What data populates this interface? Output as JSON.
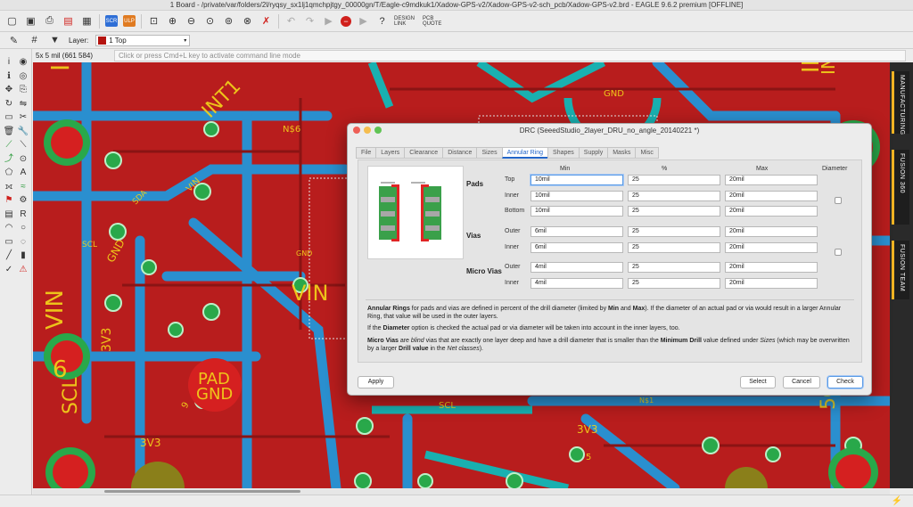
{
  "window": {
    "title": "1 Board - /private/var/folders/2l/ryqsy_sx1lj1qmchpjtgy_00000gn/T/Eagle-c9mdkuk1/Xadow-GPS-v2/Xadow-GPS-v2-sch_pcb/Xadow-GPS-v2.brd - EAGLE 9.6.2 premium [OFFLINE]"
  },
  "toolbar": {
    "design_link": "DESIGN LINK",
    "pcb_quote": "PCB QUOTE",
    "scr": "SCR",
    "ulp": "ULP"
  },
  "layerbar": {
    "label": "Layer:",
    "selected": "1 Top",
    "swatch_color": "#b4140f"
  },
  "command": {
    "coord": "5x 5 mil (661 584)",
    "placeholder": "Click or press Cmd+L key to activate command line mode"
  },
  "right_tabs": [
    "MANUFACTURING",
    "FUSION 360",
    "FUSION TEAM"
  ],
  "canvas_labels": [
    "INT1",
    "INT1",
    "INT1",
    "INT1",
    "VIN",
    "3V3",
    "VIN",
    "PAD",
    "GND",
    "GND",
    "GND",
    "SCL",
    "SCL",
    "5CL",
    "3V3",
    "3V3",
    "N$6",
    "N$1",
    "GND",
    "VIN",
    "SCL",
    "SDA",
    "6",
    "9",
    "1",
    "5"
  ],
  "dialog": {
    "title": "DRC (SeeedStudio_2layer_DRU_no_angle_20140221 *)",
    "tabs": [
      "File",
      "Layers",
      "Clearance",
      "Distance",
      "Sizes",
      "Annular Ring",
      "Shapes",
      "Supply",
      "Masks",
      "Misc"
    ],
    "active_tab": "Annular Ring",
    "col_min": "Min",
    "col_pct": "%",
    "col_max": "Max",
    "col_diameter": "Diameter",
    "groups": {
      "pads": "Pads",
      "vias": "Vias",
      "micro_vias": "Micro Vias"
    },
    "rows": [
      {
        "label": "Top",
        "min": "10mil",
        "pct": "25",
        "max": "20mil"
      },
      {
        "label": "Inner",
        "min": "10mil",
        "pct": "25",
        "max": "20mil"
      },
      {
        "label": "Bottom",
        "min": "10mil",
        "pct": "25",
        "max": "20mil"
      },
      {
        "label": "Outer",
        "min": "6mil",
        "pct": "25",
        "max": "20mil"
      },
      {
        "label": "Inner",
        "min": "6mil",
        "pct": "25",
        "max": "20mil"
      },
      {
        "label": "Outer",
        "min": "4mil",
        "pct": "25",
        "max": "20mil"
      },
      {
        "label": "Inner",
        "min": "4mil",
        "pct": "25",
        "max": "20mil"
      }
    ],
    "desc1": "Annular Rings for pads and vias are defined in percent of the drill diameter (limited by Min and Max). If the diameter of an actual pad or via would result in a larger Annular Ring, that value will be used in the outer layers.",
    "desc2": "If the Diameter option is checked the actual pad or via diameter will be taken into account in the inner layers, too.",
    "desc3": "Micro Vias are blind vias that are exactly one layer deep and have a drill diameter that is smaller than the Minimum Drill value defined under Sizes (which may be overwritten by a larger Drill value in the Net classes).",
    "buttons": {
      "apply": "Apply",
      "select": "Select",
      "cancel": "Cancel",
      "check": "Check"
    }
  }
}
